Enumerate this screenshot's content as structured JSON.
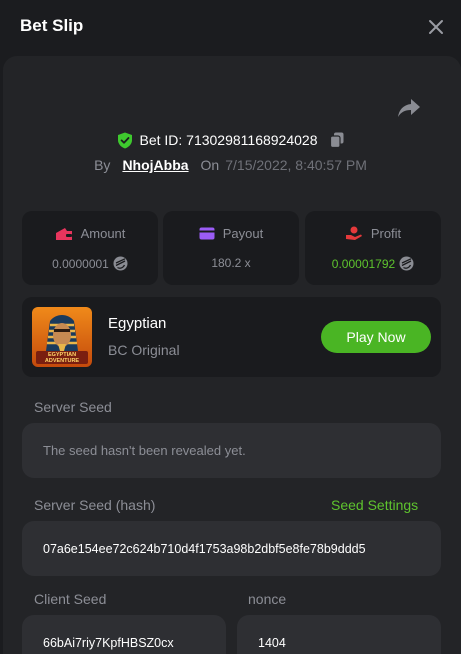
{
  "header": {
    "title": "Bet Slip"
  },
  "bet": {
    "id_label": "Bet ID: 71302981168924028",
    "by_label": "By",
    "username": "NhojAbba",
    "on_label": "On",
    "date": "7/15/2022, 8:40:57 PM"
  },
  "stats": {
    "amount": {
      "label": "Amount",
      "value": "0.0000001"
    },
    "payout": {
      "label": "Payout",
      "value": "180.2 x"
    },
    "profit": {
      "label": "Profit",
      "value": "0.00001792"
    }
  },
  "game": {
    "name": "Egyptian",
    "provider": "BC Original",
    "thumb_text": "EGYPTIAN ADVENTURE",
    "play_label": "Play Now"
  },
  "seeds": {
    "server_seed_label": "Server Seed",
    "server_seed_placeholder": "The seed hasn't been revealed yet.",
    "server_hash_label": "Server Seed (hash)",
    "seed_settings_label": "Seed Settings",
    "server_hash": "07a6e154ee72c624b710d4f1753a98b2dbf5e8fe78b9ddd5",
    "client_seed_label": "Client Seed",
    "client_seed": "66bAi7riy7KpfHBSZ0cx",
    "nonce_label": "nonce",
    "nonce": "1404"
  },
  "colors": {
    "accent_green": "#5ec32e",
    "play_button": "#4ab524",
    "shield_green": "#3ec92e",
    "amount_icon": "#e8355d",
    "payout_icon": "#9b5cf6",
    "profit_icon": "#e5393b"
  },
  "icons": {
    "close": "close-icon",
    "share": "share-icon",
    "shield": "shield-check-icon",
    "copy": "copy-icon",
    "amount": "wallet-icon",
    "payout": "card-icon",
    "profit": "hand-coin-icon",
    "coin": "xlm-coin-icon"
  }
}
